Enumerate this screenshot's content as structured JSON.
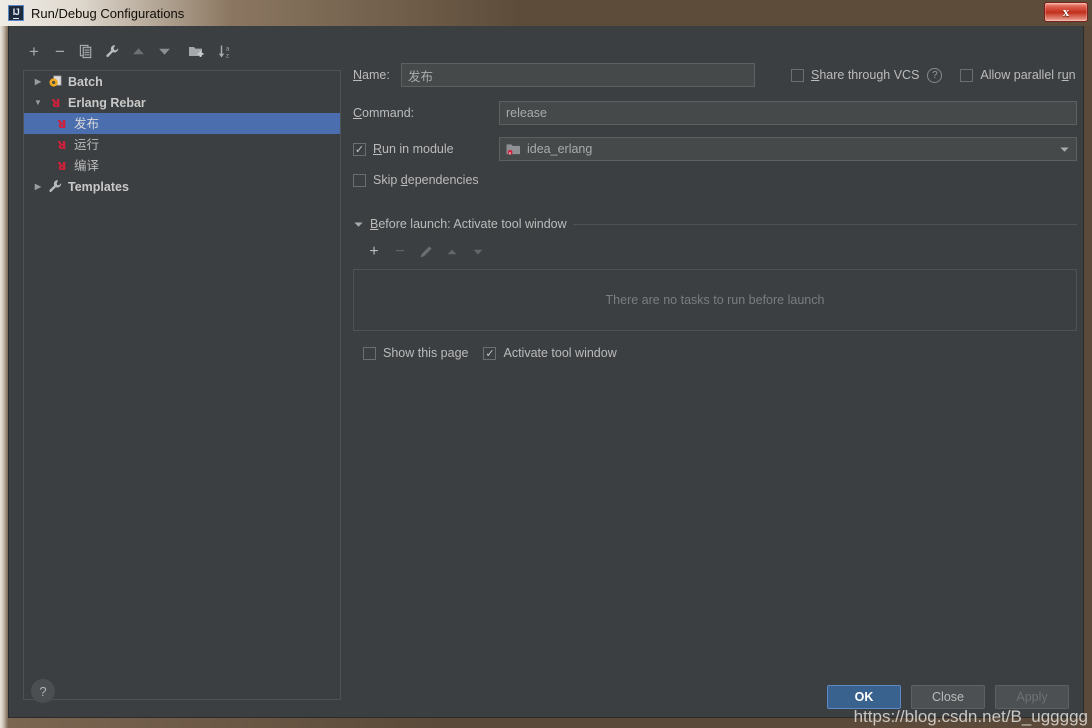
{
  "window": {
    "title": "Run/Debug Configurations",
    "app_icon": "intellij-idea-icon",
    "close_label": "x"
  },
  "toolbar": {
    "items": [
      {
        "name": "add-configuration-button",
        "icon": "plus-icon",
        "glyph": "+",
        "enabled": true
      },
      {
        "name": "remove-configuration-button",
        "icon": "minus-icon",
        "glyph": "−",
        "enabled": true
      },
      {
        "name": "copy-configuration-button",
        "icon": "copy-icon",
        "glyph": "",
        "enabled": true
      },
      {
        "name": "edit-templates-button",
        "icon": "wrench-icon",
        "glyph": "",
        "enabled": true
      },
      {
        "name": "move-up-button",
        "icon": "arrow-up-icon",
        "glyph": "",
        "enabled": false
      },
      {
        "name": "move-down-button",
        "icon": "arrow-down-icon",
        "glyph": "",
        "enabled": false
      },
      {
        "name": "move-into-folder-button",
        "icon": "folder-add-icon",
        "glyph": "",
        "enabled": true
      },
      {
        "name": "sort-configurations-button",
        "icon": "sort-az-icon",
        "glyph": "",
        "enabled": true
      }
    ]
  },
  "tree": {
    "nodes": [
      {
        "label": "Batch",
        "icon": "batch-gear-icon",
        "level": 0,
        "expanded": false,
        "bold": true,
        "selected": false,
        "has_twisty": true
      },
      {
        "label": "Erlang Rebar",
        "icon": "erlang-icon",
        "level": 0,
        "expanded": true,
        "bold": true,
        "selected": false,
        "has_twisty": true
      },
      {
        "label": "发布",
        "icon": "erlang-icon",
        "level": 1,
        "expanded": false,
        "bold": false,
        "selected": true,
        "has_twisty": false
      },
      {
        "label": "运行",
        "icon": "erlang-icon",
        "level": 1,
        "expanded": false,
        "bold": false,
        "selected": false,
        "has_twisty": false
      },
      {
        "label": "编译",
        "icon": "erlang-icon",
        "level": 1,
        "expanded": false,
        "bold": false,
        "selected": false,
        "has_twisty": false
      },
      {
        "label": "Templates",
        "icon": "wrench-icon",
        "level": 0,
        "expanded": false,
        "bold": true,
        "selected": false,
        "has_twisty": true
      }
    ]
  },
  "form": {
    "name_label": "Name:",
    "name_value": "发布",
    "name_placeholder": "",
    "share_vcs_label": "Share through VCS",
    "share_vcs_checked": false,
    "share_vcs_help": "?",
    "allow_parallel_label": "Allow parallel run",
    "allow_parallel_checked": false,
    "command_label": "Command:",
    "command_value": "release",
    "run_in_module_label": "Run in module",
    "run_in_module_checked": true,
    "module_value": "idea_erlang",
    "module_icon": "module-folder-icon",
    "skip_dependencies_label": "Skip dependencies",
    "skip_dependencies_checked": false,
    "before_launch_title": "Before launch: Activate tool window",
    "before_launch_toolbar": [
      {
        "name": "add-task-button",
        "icon": "plus-icon",
        "glyph": "+",
        "enabled": true
      },
      {
        "name": "remove-task-button",
        "icon": "minus-icon",
        "glyph": "−",
        "enabled": false
      },
      {
        "name": "edit-task-button",
        "icon": "pencil-icon",
        "glyph": "",
        "enabled": false
      },
      {
        "name": "task-move-up-button",
        "icon": "arrow-up-icon",
        "glyph": "",
        "enabled": false
      },
      {
        "name": "task-move-down-button",
        "icon": "arrow-down-icon",
        "glyph": "",
        "enabled": false
      }
    ],
    "no_tasks_text": "There are no tasks to run before launch",
    "show_page_label": "Show this page",
    "show_page_checked": false,
    "activate_tool_window_label": "Activate tool window",
    "activate_tool_window_checked": true
  },
  "footer": {
    "help_label": "?",
    "ok_label": "OK",
    "close_label": "Close",
    "apply_label": "Apply",
    "apply_enabled": false
  },
  "watermark": "https://blog.csdn.net/B_uggggg",
  "colors": {
    "panel_bg": "#3c3f41",
    "field_bg": "#45494a",
    "selection_blue": "#4b6eaf",
    "accent_ok": "#3a628f",
    "erlang_red": "#d0203b",
    "titlebar_brown": "#5d4c3a",
    "close_red": "#c22f1d"
  }
}
